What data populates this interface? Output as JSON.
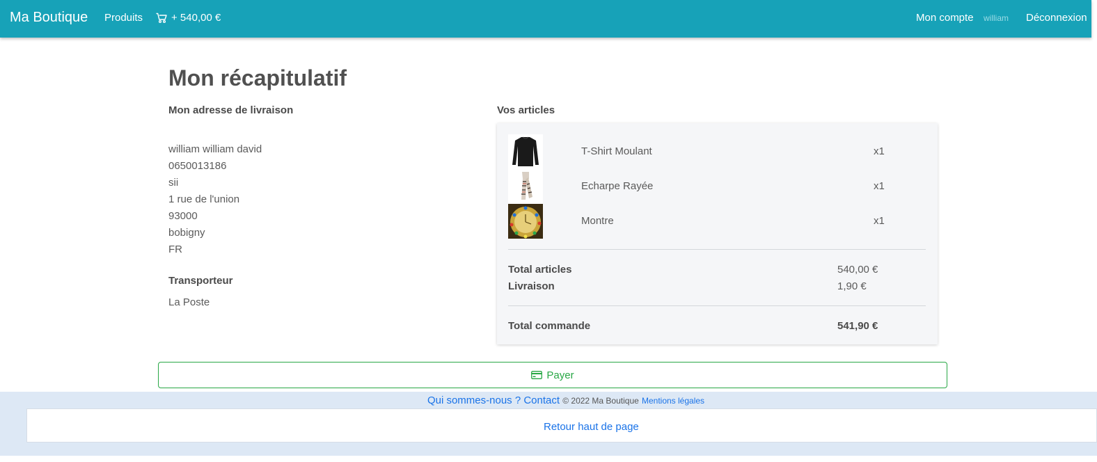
{
  "navbar": {
    "brand": "Ma Boutique",
    "produits": "Produits",
    "cart_total": "+ 540,00 €",
    "account": "Mon compte",
    "username": "william",
    "logout": "Déconnexion"
  },
  "page": {
    "title": "Mon récapitulatif",
    "address_heading": "Mon adresse de livraison",
    "address_lines": [
      "william william david",
      "0650013186",
      "sii",
      "1 rue de l'union",
      "93000",
      "bobigny",
      "FR"
    ],
    "carrier_heading": "Transporteur",
    "carrier": "La Poste"
  },
  "articles": {
    "heading": "Vos articles",
    "items": [
      {
        "name": "T-Shirt Moulant",
        "qty": "x1",
        "image": "black-longsleeve-shirt"
      },
      {
        "name": "Echarpe Rayée",
        "qty": "x1",
        "image": "striped-scarf"
      },
      {
        "name": "Montre",
        "qty": "x1",
        "image": "gold-watch"
      }
    ],
    "total_articles_label": "Total articles",
    "total_articles_value": "540,00 €",
    "livraison_label": "Livraison",
    "livraison_value": "1,90 €",
    "total_commande_label": "Total commande",
    "total_commande_value": "541,90 €"
  },
  "pay_button": {
    "label": "Payer",
    "icon": "credit-card-icon"
  },
  "footer": {
    "qui": "Qui sommes-nous ?",
    "contact": "Contact",
    "copyright": "© 2022 Ma Boutique",
    "mentions": "Mentions légales",
    "back_top": "Retour haut de page"
  },
  "colors": {
    "navbar": "#17a2b8",
    "pay": "#28a745",
    "link": "#1a73e8",
    "footer": "#dde8f5"
  }
}
